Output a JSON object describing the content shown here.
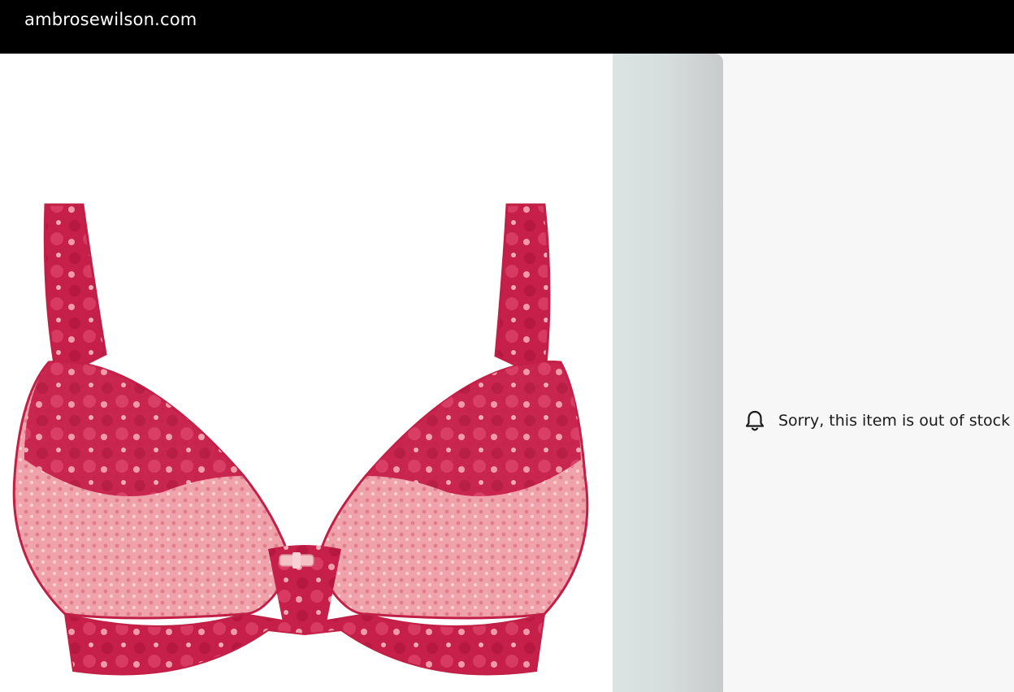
{
  "browser": {
    "url": "ambrosewilson.com"
  },
  "product": {
    "image_icon": "lace-bra-product-image",
    "colors": {
      "lace_dark": "#c5204a",
      "lace_light": "#f2a3ab",
      "bow": "#f4c1c6"
    }
  },
  "availability": {
    "icon": "bell-icon",
    "message": "Sorry, this item is out of stock"
  }
}
